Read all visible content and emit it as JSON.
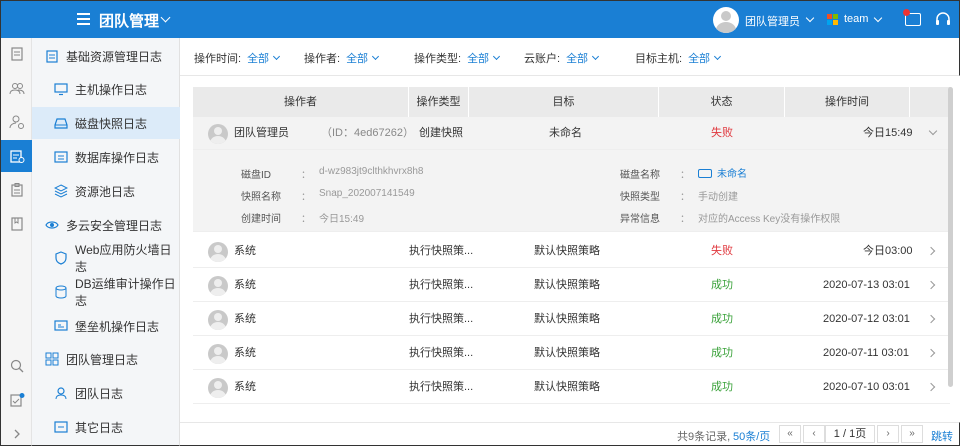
{
  "header": {
    "title": "团队管理",
    "username": "团队管理员",
    "team": "team",
    "brand_color": "#1a7fd4"
  },
  "rail": {
    "icons": [
      "document-icon",
      "users-icon",
      "user-settings-icon",
      "log-icon",
      "clipboard-icon",
      "book-icon",
      "search-icon",
      "task-icon",
      "expand-icon"
    ]
  },
  "sidebar": {
    "groups": [
      {
        "label": "基础资源管理日志",
        "items": [
          "主机操作日志",
          "磁盘快照日志",
          "数据库操作日志",
          "资源池日志"
        ]
      },
      {
        "label": "多云安全管理日志",
        "items": [
          "Web应用防火墙日志",
          "DB运维审计操作日志",
          "堡垒机操作日志"
        ]
      },
      {
        "label": "团队管理日志",
        "items": [
          "团队日志",
          "其它日志"
        ]
      }
    ],
    "active": "磁盘快照日志"
  },
  "filters": [
    {
      "label": "操作时间:",
      "value": "全部"
    },
    {
      "label": "操作者:",
      "value": "全部"
    },
    {
      "label": "操作类型:",
      "value": "全部"
    },
    {
      "label": "云账户:",
      "value": "全部"
    },
    {
      "label": "目标主机:",
      "value": "全部"
    }
  ],
  "table": {
    "headers": [
      "操作者",
      "操作类型",
      "目标",
      "状态",
      "操作时间"
    ],
    "expanded_row": {
      "operator": "团队管理员",
      "operator_id": "（ID：4ed67262）",
      "type": "创建快照",
      "target": "未命名",
      "status": "失败",
      "time": "今日15:49",
      "details": {
        "disk_id_label": "磁盘ID",
        "disk_id": "d-wz983jt9clthkhvrx8h8",
        "snap_name_label": "快照名称",
        "snap_name": "Snap_202007141549",
        "created_label": "创建时间",
        "created": "今日15:49",
        "disk_name_label": "磁盘名称",
        "disk_name": "未命名",
        "snap_type_label": "快照类型",
        "snap_type": "手动创建",
        "error_label": "异常信息",
        "error": "对应的Access Key没有操作权限",
        "sep": "："
      }
    },
    "rows": [
      {
        "operator": "系统",
        "type": "执行快照策...",
        "target": "默认快照策略",
        "status": "失败",
        "status_kind": "fail",
        "time": "今日03:00"
      },
      {
        "operator": "系统",
        "type": "执行快照策...",
        "target": "默认快照策略",
        "status": "成功",
        "status_kind": "succ",
        "time": "2020-07-13 03:01"
      },
      {
        "operator": "系统",
        "type": "执行快照策...",
        "target": "默认快照策略",
        "status": "成功",
        "status_kind": "succ",
        "time": "2020-07-12 03:01"
      },
      {
        "operator": "系统",
        "type": "执行快照策...",
        "target": "默认快照策略",
        "status": "成功",
        "status_kind": "succ",
        "time": "2020-07-11 03:01"
      },
      {
        "operator": "系统",
        "type": "执行快照策...",
        "target": "默认快照策略",
        "status": "成功",
        "status_kind": "succ",
        "time": "2020-07-10 03:01"
      }
    ]
  },
  "pager": {
    "total": "共9条记录,",
    "page_size": "50条/页",
    "page": "1 / 1页",
    "first": "«",
    "prev": "‹",
    "next": "›",
    "last": "»",
    "jump": "跳转"
  },
  "colors": {
    "fail": "#e0383e",
    "success": "#3aa23a",
    "link": "#1a7fd4"
  }
}
